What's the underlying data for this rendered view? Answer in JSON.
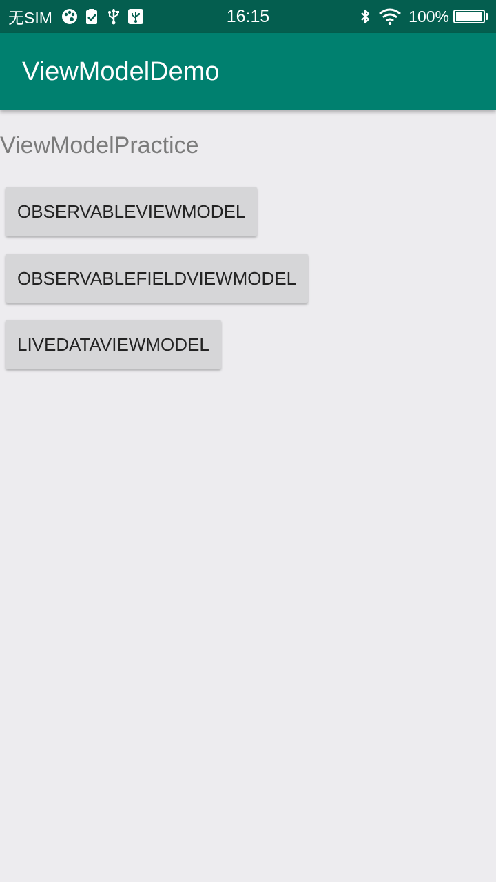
{
  "status_bar": {
    "carrier": "无SIM",
    "time": "16:15",
    "battery_percent": "100%",
    "battery_level": 1.0,
    "left_icons": [
      "palette-icon",
      "clipboard-check-icon",
      "usb-icon",
      "usb-debug-icon"
    ],
    "right_icons": [
      "bluetooth-icon",
      "wifi-icon",
      "battery-icon"
    ]
  },
  "app_bar": {
    "title": "ViewModelDemo",
    "color": "#00806f"
  },
  "main": {
    "heading": "ViewModelPractice",
    "buttons": [
      {
        "label": "OBSERVABLEVIEWMODEL"
      },
      {
        "label": "OBSERVABLEFIELDVIEWMODEL"
      },
      {
        "label": "LIVEDATAVIEWMODEL"
      }
    ]
  }
}
